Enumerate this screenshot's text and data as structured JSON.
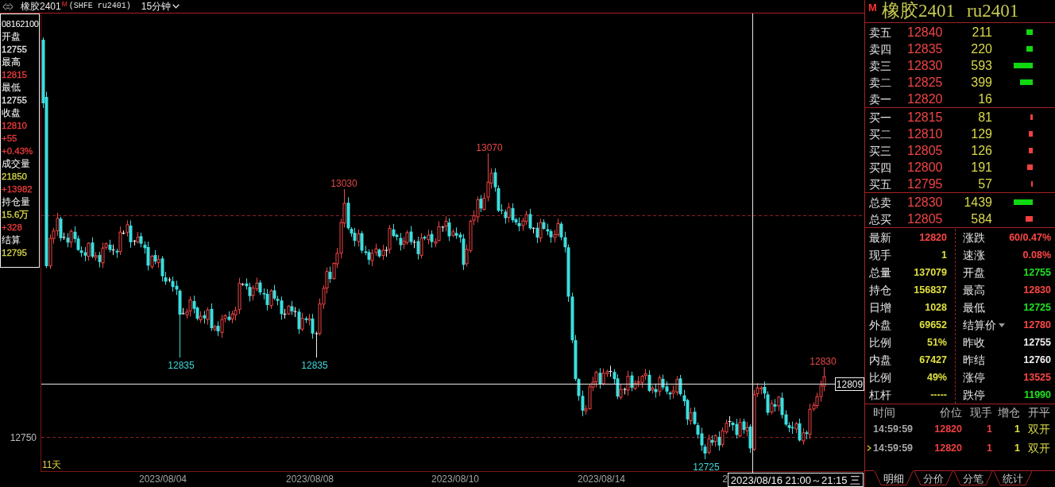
{
  "header": {
    "symbol": "橡胶2401",
    "badge": "M",
    "code": "(SHFE ru2401)",
    "period": "15分钟"
  },
  "info_panel": {
    "time": "08162100",
    "fields": [
      {
        "label": "开盘",
        "values": [
          {
            "text": "12755",
            "color": "#e8e8e8"
          }
        ]
      },
      {
        "label": "最高",
        "values": [
          {
            "text": "12815",
            "color": "#f03c3c"
          }
        ]
      },
      {
        "label": "最低",
        "values": [
          {
            "text": "12755",
            "color": "#e8e8e8"
          }
        ]
      },
      {
        "label": "收盘",
        "values": [
          {
            "text": "12810",
            "color": "#f03c3c"
          },
          {
            "text": "+55",
            "color": "#f03c3c"
          },
          {
            "text": "+0.43%",
            "color": "#f03c3c"
          }
        ]
      },
      {
        "label": "成交量",
        "values": [
          {
            "text": "21850",
            "color": "#d8d84a"
          },
          {
            "text": "+13982",
            "color": "#f03c3c"
          }
        ]
      },
      {
        "label": "持仓量",
        "values": [
          {
            "text": "15.6万",
            "color": "#d8d84a"
          },
          {
            "text": "+328",
            "color": "#f03c3c"
          }
        ]
      },
      {
        "label": "结算",
        "values": [
          {
            "text": "12795",
            "color": "#d8d84a"
          }
        ]
      }
    ]
  },
  "chart": {
    "price_tick": "12750",
    "span": "11天",
    "markers": [
      {
        "kind": "low",
        "text": "12835"
      },
      {
        "kind": "low",
        "text": "12835"
      },
      {
        "kind": "high",
        "text": "13030"
      },
      {
        "kind": "high",
        "text": "13070"
      },
      {
        "kind": "low",
        "text": "12725"
      },
      {
        "kind": "high",
        "text": "12830"
      }
    ],
    "crosshair": {
      "price": "12809",
      "time": "2023/08/16 21:00～21:15 三"
    },
    "date_labels": [
      "2023/08/04",
      "2023/08/08",
      "2023/08/10",
      "2023/08/14",
      "2"
    ]
  },
  "quote": {
    "badge": "M",
    "name": "橡胶2401",
    "code": "ru2401"
  },
  "order_book": {
    "sell": [
      {
        "label": "卖五",
        "price": "12840",
        "volume": "211"
      },
      {
        "label": "卖四",
        "price": "12835",
        "volume": "220"
      },
      {
        "label": "卖三",
        "price": "12830",
        "volume": "593"
      },
      {
        "label": "卖二",
        "price": "12825",
        "volume": "399"
      },
      {
        "label": "卖一",
        "price": "12820",
        "volume": "16"
      }
    ],
    "buy": [
      {
        "label": "买一",
        "price": "12815",
        "volume": "81"
      },
      {
        "label": "买二",
        "price": "12810",
        "volume": "129"
      },
      {
        "label": "买三",
        "price": "12805",
        "volume": "126"
      },
      {
        "label": "买四",
        "price": "12800",
        "volume": "191"
      },
      {
        "label": "买五",
        "price": "12795",
        "volume": "57"
      }
    ],
    "totals": [
      {
        "kind": "sell",
        "label": "总卖",
        "price": "12830",
        "volume": "1439"
      },
      {
        "kind": "buy",
        "label": "总买",
        "price": "12805",
        "volume": "584"
      }
    ]
  },
  "stats": {
    "left": [
      {
        "label": "最新",
        "value": "12820",
        "color": "#ff4646"
      },
      {
        "label": "现手",
        "value": "1",
        "color": "#e0e040"
      },
      {
        "label": "总量",
        "value": "137079",
        "color": "#e0e040"
      },
      {
        "label": "持仓",
        "value": "156837",
        "color": "#e0e040"
      },
      {
        "label": "日增",
        "value": "1028",
        "color": "#e0e040"
      },
      {
        "label": "外盘",
        "value": "69652",
        "color": "#e0e040"
      },
      {
        "label": "比例",
        "value": "51%",
        "color": "#e0e040"
      },
      {
        "label": "内盘",
        "value": "67427",
        "color": "#e0e040"
      },
      {
        "label": "比例",
        "value": "49%",
        "color": "#e0e040"
      },
      {
        "label": "杠杆",
        "value": "-----",
        "color": "#e0e040"
      }
    ],
    "right": [
      {
        "label": "涨跌",
        "value": "60/0.47%",
        "color": "#ff4646",
        "dropdown": false
      },
      {
        "label": "速涨",
        "value": "0.08%",
        "color": "#ff4646",
        "dropdown": false
      },
      {
        "label": "开盘",
        "value": "12755",
        "color": "#22e022",
        "dropdown": false
      },
      {
        "label": "最高",
        "value": "12830",
        "color": "#ff4646",
        "dropdown": false
      },
      {
        "label": "最低",
        "value": "12725",
        "color": "#22e022",
        "dropdown": false
      },
      {
        "label": "结算价",
        "value": "12780",
        "color": "#ff4646",
        "dropdown": true
      },
      {
        "label": "昨收",
        "value": "12755",
        "color": "#f0f0f0",
        "dropdown": false
      },
      {
        "label": "昨结",
        "value": "12760",
        "color": "#f0f0f0",
        "dropdown": false
      },
      {
        "label": "涨停",
        "value": "13525",
        "color": "#ff4646",
        "dropdown": false
      },
      {
        "label": "跌停",
        "value": "11990",
        "color": "#22e022",
        "dropdown": false
      }
    ]
  },
  "ticks": {
    "columns": [
      "时间",
      "价位",
      "现手",
      "增仓",
      "开平"
    ],
    "rows": [
      {
        "time": "14:59:59",
        "price": "12820",
        "volume": "1",
        "change": "1",
        "type": "双开",
        "selected": false
      },
      {
        "time": "14:59:59",
        "price": "12820",
        "volume": "1",
        "change": "1",
        "type": "双开",
        "selected": true
      }
    ]
  },
  "tabs": [
    {
      "label": "明细",
      "selected": true
    },
    {
      "label": "分价",
      "selected": false
    },
    {
      "label": "分笔",
      "selected": false
    },
    {
      "label": "统计",
      "selected": false
    }
  ]
}
